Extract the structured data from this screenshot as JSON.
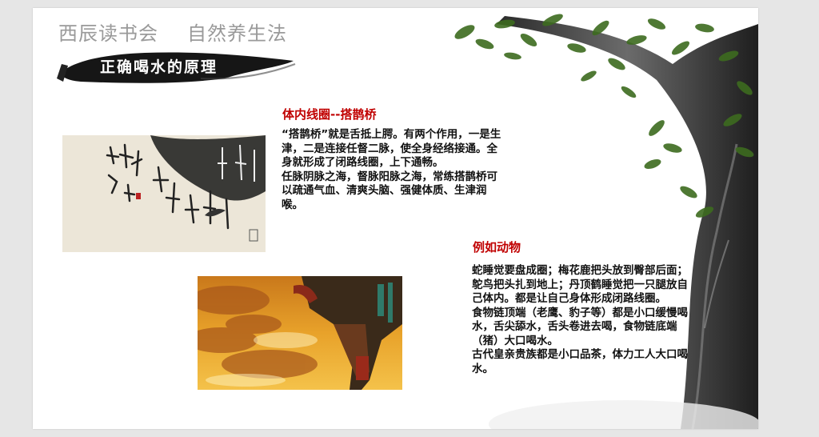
{
  "header": {
    "title_left": "西辰读书会",
    "title_right": "自然养生法",
    "subtitle": "正确喝水的原理"
  },
  "section1": {
    "heading": "体内线圈--搭鹊桥",
    "paragraphs": [
      "“搭鹊桥”就是舌抵上腭。有两个作用，一是生津，二是连接任督二脉，使全身经络接通。全身就形成了闭路线圈，上下通畅。",
      "任脉阴脉之海，督脉阳脉之海，常练搭鹊桥可以疏通气血、清爽头脑、强健体质、生津润喉。"
    ]
  },
  "section2": {
    "heading": "例如动物",
    "paragraphs": [
      "蛇睡觉要盘成圈；梅花鹿把头放到臀部后面；鸵鸟把头扎到地上；丹顶鹤睡觉把一只腿放自己体内。都是让自己身体形成闭路线圈。",
      "食物链顶端（老鹰、豹子等）都是小口缓慢喝水，舌尖舔水，舌头卷进去喝，食物链底端（猪）大口喝水。",
      "古代皇亲贵族都是小口品茶，体力工人大口喝水。"
    ]
  },
  "colors": {
    "heading_red": "#c00000",
    "page_bg": "#e6e6e6",
    "slide_bg": "#ffffff"
  }
}
